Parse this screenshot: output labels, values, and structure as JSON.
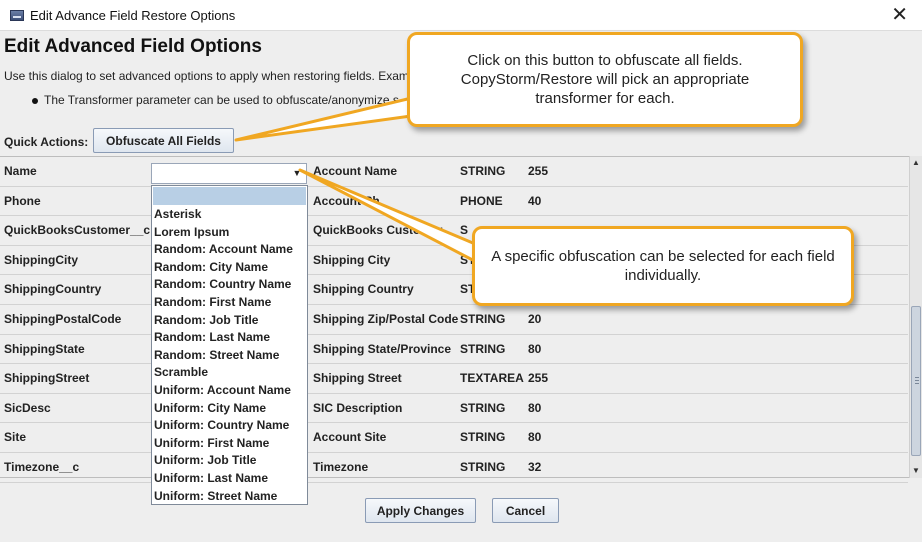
{
  "window": {
    "title": "Edit Advance Field Restore Options"
  },
  "heading": "Edit Advanced Field Options",
  "description": "Use this dialog to set advanced options to apply when restoring fields. Example",
  "bullet": "The Transformer parameter can be used to obfuscate/anonymize s",
  "quick_actions": {
    "label": "Quick Actions:",
    "button": "Obfuscate All Fields"
  },
  "rows": [
    {
      "name": "Name",
      "label": "Account Name",
      "type": "STRING",
      "length": "255"
    },
    {
      "name": "Phone",
      "label": "Account Ph",
      "type": "PHONE",
      "length": "40"
    },
    {
      "name": "QuickBooksCustomer__c",
      "label": "QuickBooks Customer",
      "type": "S",
      "length": ""
    },
    {
      "name": "ShippingCity",
      "label": "Shipping City",
      "type": "ST",
      "length": ""
    },
    {
      "name": "ShippingCountry",
      "label": "Shipping Country",
      "type": "ST",
      "length": ""
    },
    {
      "name": "ShippingPostalCode",
      "label": "Shipping Zip/Postal Code",
      "type": "STRING",
      "length": "20"
    },
    {
      "name": "ShippingState",
      "label": "Shipping State/Province",
      "type": "STRING",
      "length": "80"
    },
    {
      "name": "ShippingStreet",
      "label": "Shipping Street",
      "type": "TEXTAREA",
      "length": "255"
    },
    {
      "name": "SicDesc",
      "label": "SIC Description",
      "type": "STRING",
      "length": "80"
    },
    {
      "name": "Site",
      "label": "Account Site",
      "type": "STRING",
      "length": "80"
    },
    {
      "name": "Timezone__c",
      "label": "Timezone",
      "type": "STRING",
      "length": "32"
    }
  ],
  "dropdown_options": [
    "Asterisk",
    "Lorem Ipsum",
    "Random: Account Name",
    "Random: City Name",
    "Random: Country Name",
    "Random: First Name",
    "Random: Job Title",
    "Random: Last Name",
    "Random: Street Name",
    "Scramble",
    "Uniform: Account Name",
    "Uniform: City Name",
    "Uniform: Country Name",
    "Uniform: First Name",
    "Uniform: Job Title",
    "Uniform: Last Name",
    "Uniform: Street Name"
  ],
  "buttons": {
    "apply": "Apply Changes",
    "cancel": "Cancel"
  },
  "callouts": {
    "obfuscate_all": "Click on this button to obfuscate all fields. CopyStorm/Restore will pick an appropriate transformer for each.",
    "per_field": "A specific obfuscation can be selected for each field individually."
  },
  "colors": {
    "callout_border": "#f0a722",
    "selection": "#b8cfe5"
  }
}
